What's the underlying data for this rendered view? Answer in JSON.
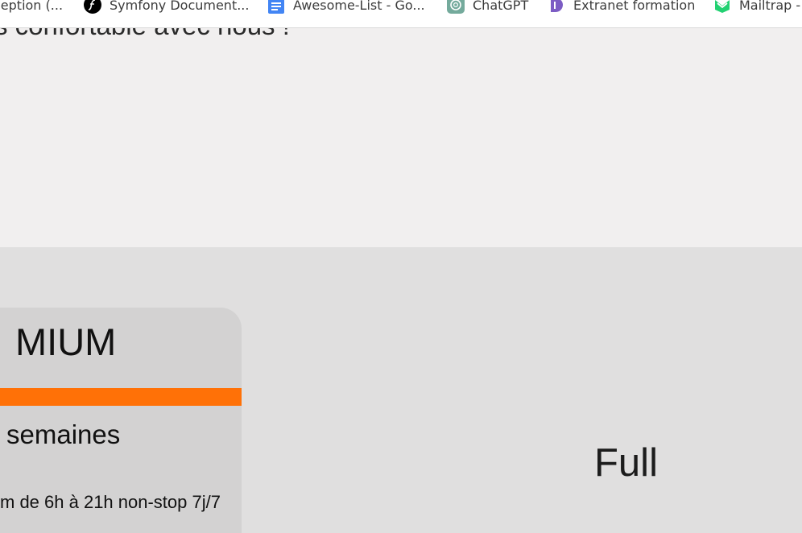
{
  "bookmarks": [
    {
      "label": "ception (...",
      "icon": "none"
    },
    {
      "label": "Symfony Document...",
      "icon": "symfony-icon"
    },
    {
      "label": "Awesome-List - Go...",
      "icon": "google-docs-icon"
    },
    {
      "label": "ChatGPT",
      "icon": "chatgpt-icon"
    },
    {
      "label": "Extranet formation",
      "icon": "extranet-icon"
    },
    {
      "label": "Mailtrap -",
      "icon": "mailtrap-icon"
    }
  ],
  "hero": {
    "text": "s confortable avec nous !"
  },
  "premium_card": {
    "title": "MIUM",
    "duration": "semaines",
    "hours": "m de 6h à 21h non-stop 7j/7",
    "accent_color": "#ff7107"
  },
  "full_plan": {
    "title": "Full"
  },
  "colors": {
    "hero_bg": "#f1efef",
    "section_bg": "#e0dfdf",
    "card_bg": "#d3d2d2"
  }
}
